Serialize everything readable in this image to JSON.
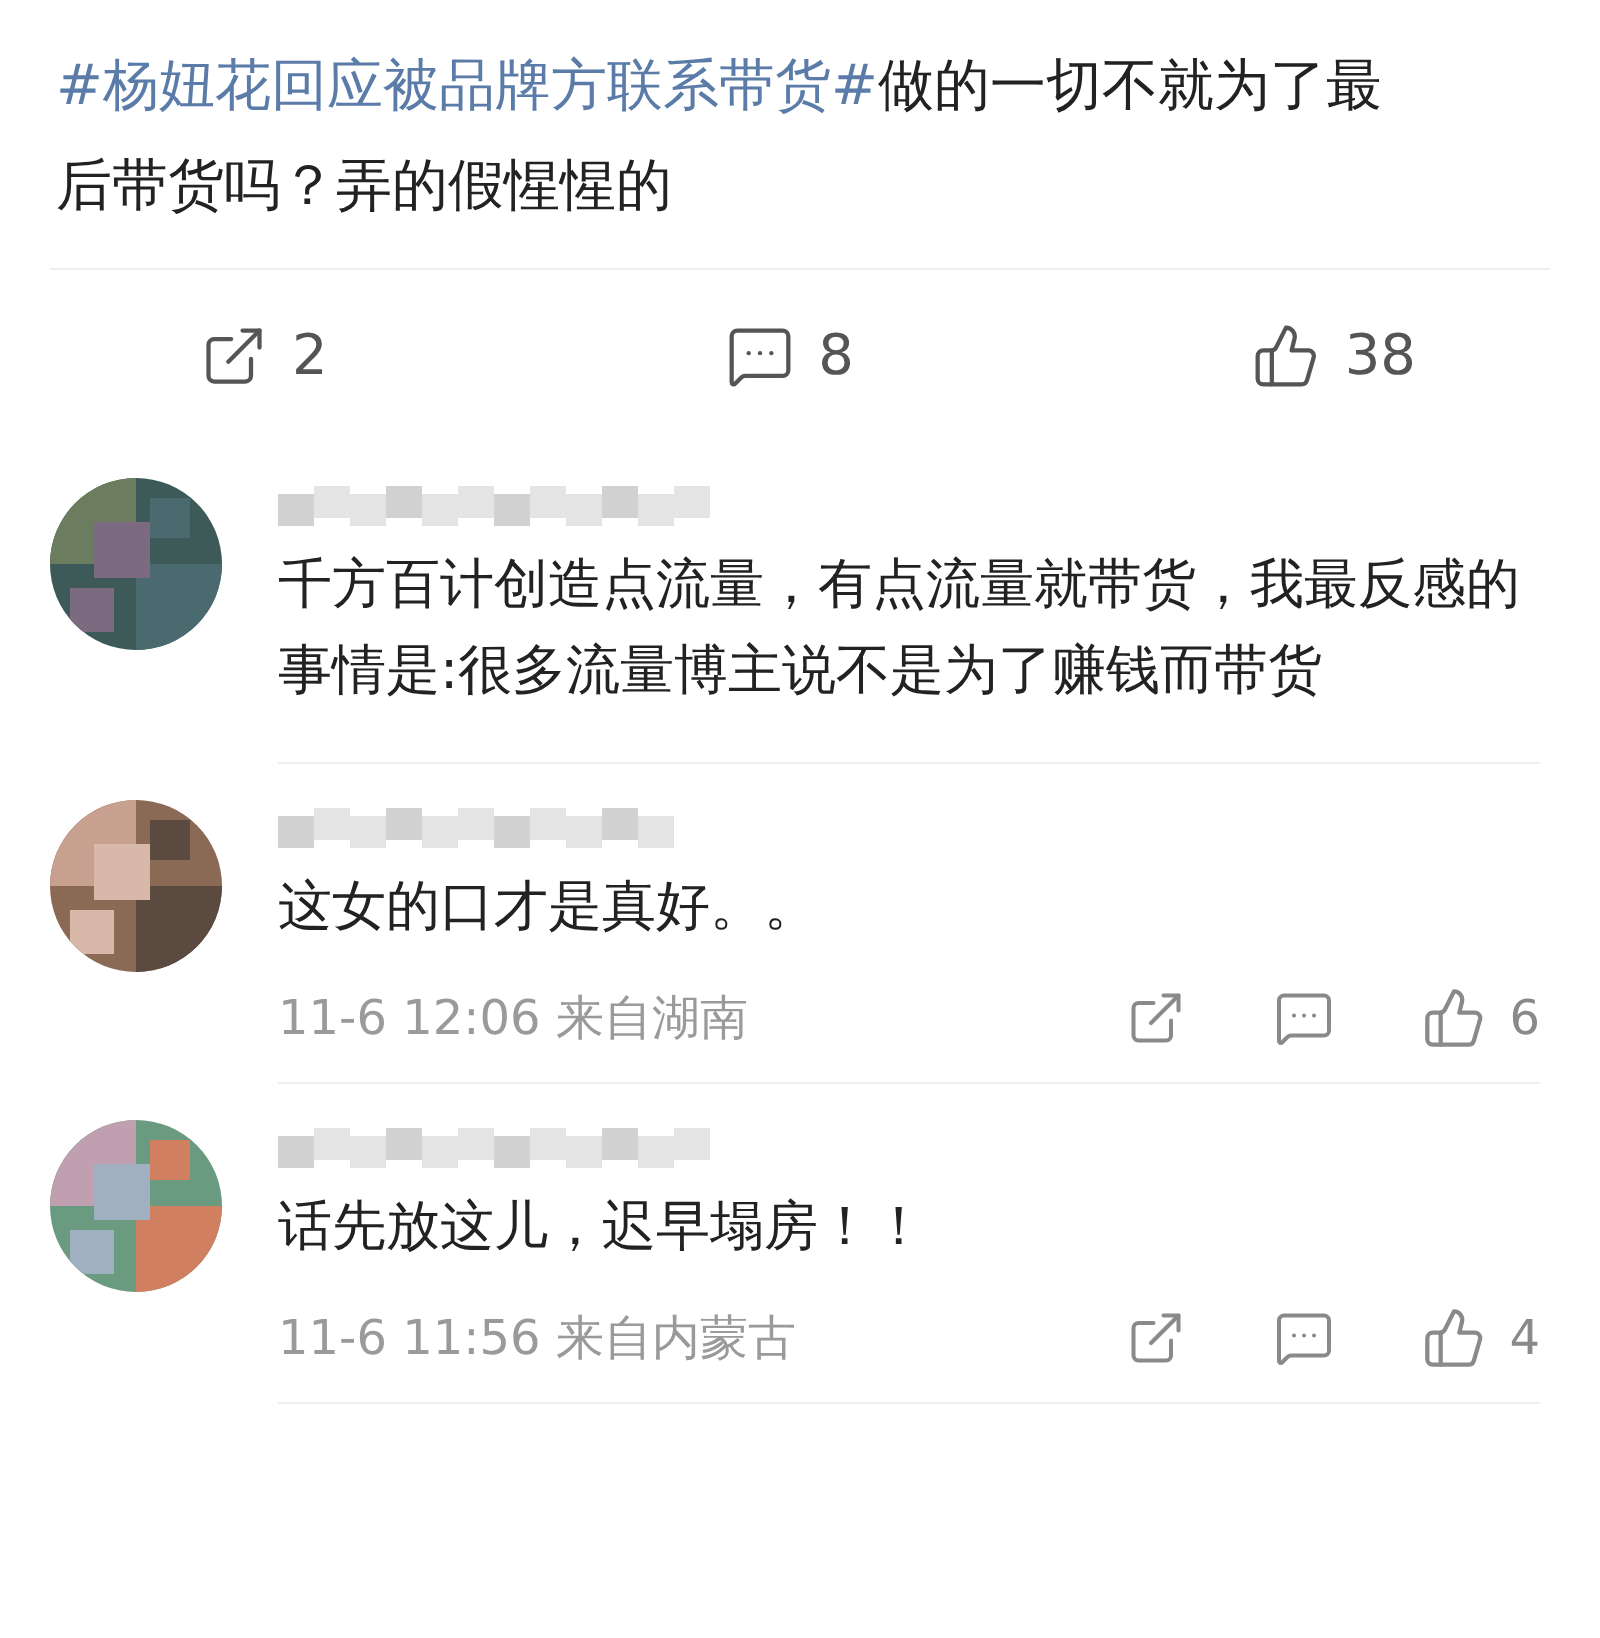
{
  "post": {
    "topic": "#杨妞花回应被品牌方联系带货#",
    "text": "做的一切不就为了最后带货吗？弄的假惺惺的"
  },
  "stats": [
    {
      "kind": "share",
      "count": "2"
    },
    {
      "kind": "comment",
      "count": "8"
    },
    {
      "kind": "like",
      "count": "38"
    }
  ],
  "comments": [
    {
      "text": "千方百计创造点流量，有点流量就带货，我最反感的事情是:很多流量博主说不是为了赚钱而带货"
    },
    {
      "text": "这女的口才是真好。。",
      "time": "11-6 12:06",
      "location": "来自湖南",
      "likes": "6"
    },
    {
      "text": "话先放这儿，迟早塌房！！",
      "time": "11-6 11:56",
      "location": "来自内蒙古",
      "likes": "4"
    }
  ]
}
